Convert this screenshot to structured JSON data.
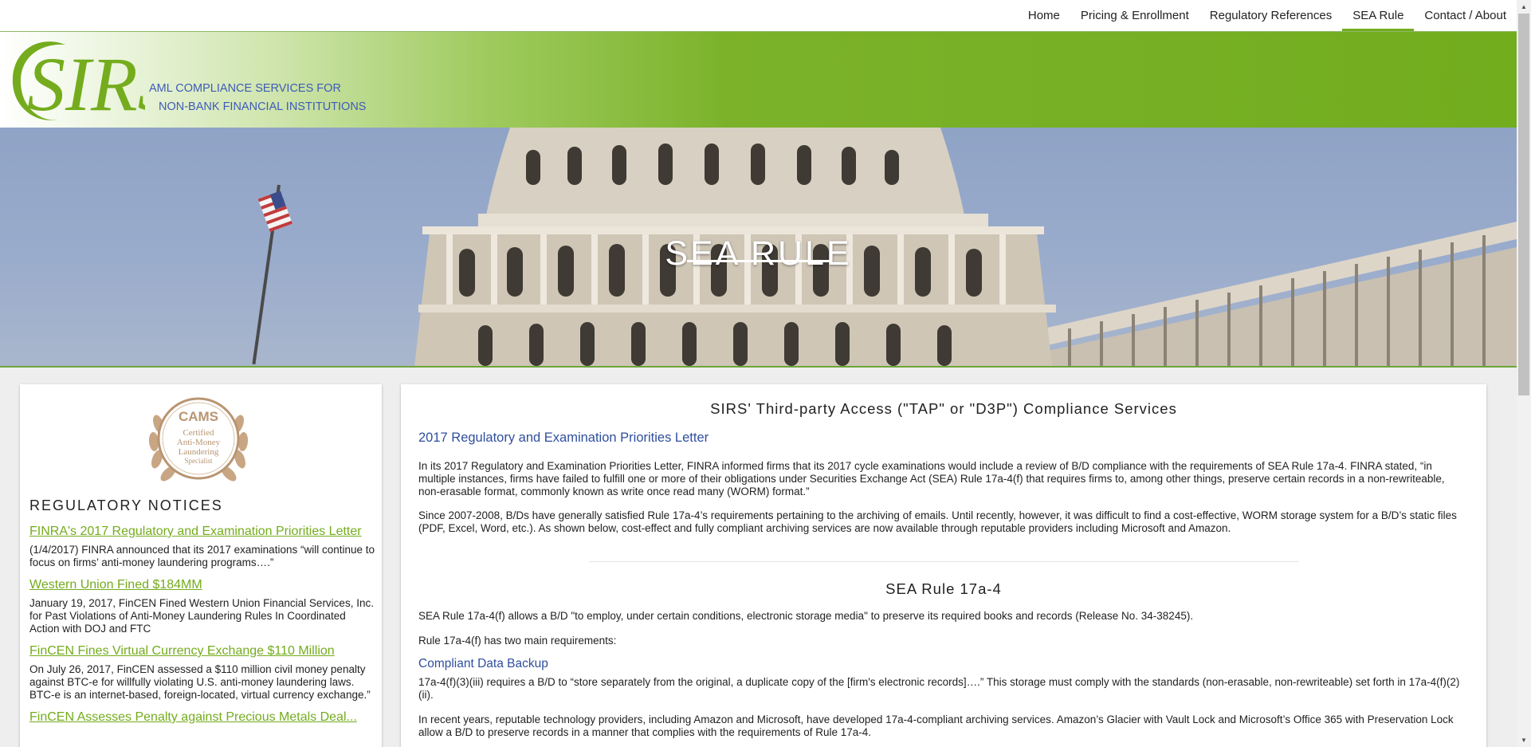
{
  "nav": {
    "items": [
      "Home",
      "Pricing & Enrollment",
      "Regulatory References",
      "SEA Rule",
      "Contact / About"
    ],
    "active": "SEA Rule"
  },
  "header": {
    "logo_text": "SIRS",
    "tagline_line1": "AML COMPLIANCE SERVICES FOR",
    "tagline_line2": "NON-BANK FINANCIAL INSTITUTIONS"
  },
  "hero": {
    "title": "SEA RULE"
  },
  "sidebar": {
    "badge": {
      "title": "CAMS",
      "line1": "Certified",
      "line2": "Anti-Money",
      "line3": "Laundering",
      "line4": "Specialist"
    },
    "heading": "REGULATORY NOTICES",
    "notices": [
      {
        "title": "FINRA's 2017 Regulatory and Examination Priorities Letter",
        "body": "(1/4/2017) FINRA announced that its 2017 examinations “will continue to focus on firms’ anti-money laundering programs….”"
      },
      {
        "title": "Western Union Fined $184MM",
        "body": "January 19, 2017, FinCEN Fined Western Union Financial Services, Inc. for Past Violations of Anti-Money Laundering Rules In Coordinated Action with DOJ and FTC"
      },
      {
        "title": "FinCEN Fines Virtual Currency Exchange $110 Million",
        "body": "On July 26, 2017, FinCEN assessed a $110 million civil money penalty against BTC-e for willfully violating U.S. anti-money laundering laws. BTC-e is an internet-based, foreign-located, virtual currency exchange.”"
      },
      {
        "title": "FinCEN Assesses Penalty against Precious Metals Deal...",
        "body": ""
      }
    ]
  },
  "main": {
    "heading": "SIRS' Third-party Access (\"TAP\" or \"D3P\") Compliance Services",
    "subheading1": "2017 Regulatory and Examination Priorities Letter",
    "para1": "In its 2017 Regulatory and Examination Priorities Letter, FINRA informed firms that its 2017 cycle examinations would include a review of B/D compliance with the requirements of SEA Rule 17a-4. FINRA stated, “in multiple instances, firms have failed to fulfill one or more of their obligations under Securities Exchange Act (SEA) Rule 17a-4(f) that requires firms to, among other things, preserve certain records in a non-rewriteable, non-erasable format, commonly known as write once read many (WORM) format.”",
    "para2": "Since 2007-2008, B/Ds have generally satisfied Rule 17a-4’s requirements pertaining to the archiving of emails. Until recently, however, it was difficult to find a cost-effective, WORM storage system for a B/D’s static files (PDF, Excel, Word, etc.). As shown below, cost-effect and fully compliant archiving services are now available through reputable providers including Microsoft and Amazon.",
    "heading2": "SEA Rule 17a-4",
    "para3": "SEA Rule 17a-4(f) allows a B/D \"to employ, under certain conditions, electronic storage media\" to preserve its required books and records (Release No. 34-38245).",
    "para4": "Rule 17a-4(f) has two main requirements:",
    "subheading2": "Compliant Data Backup",
    "para5": "17a-4(f)(3)(iii) requires a B/D to “store separately from the original, a duplicate copy of the [firm's electronic records]….” This storage must comply with the standards (non-erasable, non-rewriteable) set forth in 17a-4(f)(2)(ii).",
    "para6": "In recent years, reputable technology providers, including Amazon and Microsoft, have developed 17a-4-compliant archiving services. Amazon’s Glacier with Vault Lock and Microsoft’s Office 365 with Preservation Lock allow a B/D to preserve records in a manner that complies with the requirements of Rule 17a-4."
  },
  "colors": {
    "brand_green": "#74ac1d",
    "link_blue": "#2f4f9e",
    "tagline_blue": "#3f5bb7"
  },
  "icons": {
    "scroll_up": "scroll-up-arrow-icon",
    "scroll_down": "scroll-down-arrow-icon"
  }
}
